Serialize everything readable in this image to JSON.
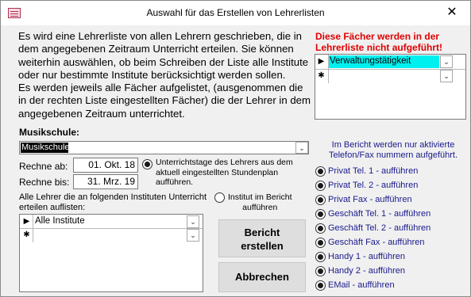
{
  "window": {
    "title": "Auswahl für das Erstellen von Lehrerlisten",
    "close_glyph": "✕"
  },
  "intro_lines": [
    "Es wird eine Lehrerliste von allen Lehrern geschrieben, die in",
    "dem angegebenen Zeitraum Unterricht erteilen. Sie können",
    "weiterhin auswählen, ob beim Schreiben der Liste alle Institute",
    "oder nur bestimmte Institute berücksichtigt werden sollen.",
    "Es werden jeweils alle Fächer aufgelistet, (ausgenommen die",
    "in der rechten Liste eingestellten Fächer) die der Lehrer in dem",
    "angegebenen Zeitraum unterrichtet."
  ],
  "excluded_subjects": {
    "heading_lines": [
      "Diese Fächer werden in der",
      "Lehrerliste nicht aufgeführt!"
    ],
    "rows": [
      {
        "value": "Verwaltungstätigkeit"
      }
    ],
    "new_row_marker": "✱",
    "selected_marker": "▶",
    "highlight_color": "#00f0f0"
  },
  "school": {
    "label": "Musikschule:",
    "value": "Musikschule"
  },
  "dates": {
    "from_label": "Rechne ab:",
    "from_value": "01. Okt. 18",
    "to_label": "Rechne bis:",
    "to_value": "31. Mrz. 19"
  },
  "scope": {
    "option1_lines": [
      "Unterrichtstage des Lehrers aus dem",
      "aktuell eingestellten Stundenplan",
      "aufführen."
    ],
    "option1_selected": true,
    "option2_lines": [
      "Institut im Bericht",
      "aufführen"
    ],
    "option2_selected": false
  },
  "institutes": {
    "label_lines": [
      "Alle Lehrer die an folgenden Instituten Unterricht",
      "erteilen auflisten:"
    ],
    "rows": [
      {
        "value": "Alle Institute"
      }
    ],
    "new_row_marker": "✱",
    "selected_marker": "▶"
  },
  "buttons": {
    "report_lines": [
      "Bericht",
      "erstellen"
    ],
    "cancel": "Abbrechen"
  },
  "report_info_lines": [
    "Im Bericht werden nur aktivierte",
    "Telefon/Fax nummern aufgeführt."
  ],
  "report_options": [
    {
      "label": "Privat Tel. 1 - aufführen",
      "selected": true
    },
    {
      "label": "Privat Tel. 2 - aufführen",
      "selected": true
    },
    {
      "label": "Privat Fax - aufführen",
      "selected": true
    },
    {
      "label": "Geschäft Tel. 1 - aufführen",
      "selected": true
    },
    {
      "label": "Geschäft Tel. 2 - aufführen",
      "selected": true
    },
    {
      "label": "Geschäft Fax - aufführen",
      "selected": true
    },
    {
      "label": "Handy 1 - aufführen",
      "selected": true
    },
    {
      "label": "Handy 2 - aufführen",
      "selected": true
    },
    {
      "label": "EMail - aufführen",
      "selected": true
    }
  ],
  "dropdown_glyph": "⌄"
}
